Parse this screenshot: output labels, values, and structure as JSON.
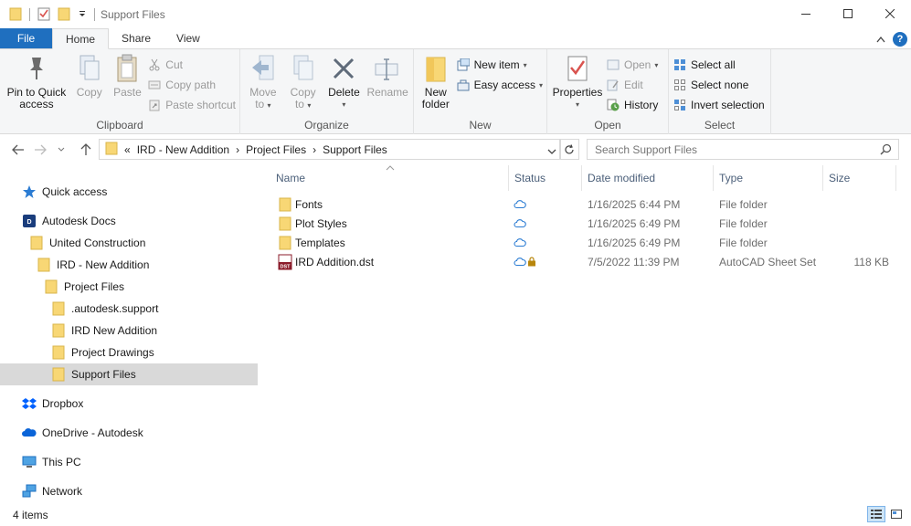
{
  "window": {
    "title": "Support Files"
  },
  "ribbon_tabs": [
    "File",
    "Home",
    "Share",
    "View"
  ],
  "ribbon": {
    "clipboard": {
      "label": "Clipboard",
      "pin_line1": "Pin to Quick",
      "pin_line2": "access",
      "copy": "Copy",
      "paste": "Paste",
      "cut": "Cut",
      "copy_path": "Copy path",
      "paste_shortcut": "Paste shortcut"
    },
    "organize": {
      "label": "Organize",
      "move_to_line1": "Move",
      "move_to_line2": "to",
      "copy_to_line1": "Copy",
      "copy_to_line2": "to",
      "delete": "Delete",
      "rename": "Rename"
    },
    "new": {
      "label": "New",
      "new_folder_line1": "New",
      "new_folder_line2": "folder",
      "new_item": "New item",
      "easy_access": "Easy access"
    },
    "open": {
      "label": "Open",
      "properties": "Properties",
      "open": "Open",
      "edit": "Edit",
      "history": "History"
    },
    "select": {
      "label": "Select",
      "select_all": "Select all",
      "select_none": "Select none",
      "invert_selection": "Invert selection"
    }
  },
  "address": {
    "prefix": "«",
    "crumbs": [
      "IRD - New Addition",
      "Project Files",
      "Support Files"
    ],
    "separator": "›"
  },
  "search": {
    "placeholder": "Search Support Files"
  },
  "nav": [
    {
      "label": "Quick access",
      "icon": "star-icon"
    },
    {
      "label": "Autodesk Docs",
      "icon": "autodesk-docs-icon"
    },
    {
      "label": "United Construction",
      "icon": "folder-icon"
    },
    {
      "label": "IRD - New Addition",
      "icon": "folder-icon"
    },
    {
      "label": "Project Files",
      "icon": "folder-icon"
    },
    {
      "label": ".autodesk.support",
      "icon": "folder-icon"
    },
    {
      "label": "IRD New Addition",
      "icon": "folder-icon"
    },
    {
      "label": "Project Drawings",
      "icon": "folder-icon"
    },
    {
      "label": "Support Files",
      "icon": "folder-icon",
      "selected": true
    },
    {
      "label": "Dropbox",
      "icon": "dropbox-icon"
    },
    {
      "label": "OneDrive - Autodesk",
      "icon": "onedrive-icon"
    },
    {
      "label": "This PC",
      "icon": "pc-icon"
    },
    {
      "label": "Network",
      "icon": "network-icon"
    }
  ],
  "columns": {
    "name": "Name",
    "status": "Status",
    "date_modified": "Date modified",
    "type": "Type",
    "size": "Size"
  },
  "files": [
    {
      "name": "Fonts",
      "date": "1/16/2025 6:44 PM",
      "type": "File folder",
      "size": "",
      "icon": "folder-icon",
      "status": "cloud-icon"
    },
    {
      "name": "Plot Styles",
      "date": "1/16/2025 6:49 PM",
      "type": "File folder",
      "size": "",
      "icon": "folder-icon",
      "status": "cloud-icon"
    },
    {
      "name": "Templates",
      "date": "1/16/2025 6:49 PM",
      "type": "File folder",
      "size": "",
      "icon": "folder-icon",
      "status": "cloud-icon"
    },
    {
      "name": "IRD Addition.dst",
      "date": "7/5/2022 11:39 PM",
      "type": "AutoCAD Sheet Set",
      "size": "118 KB",
      "icon": "dst-file-icon",
      "status": "cloud-lock-icon",
      "dst_badge": "DST"
    }
  ],
  "status_bar": {
    "item_count": "4 items"
  },
  "colors": {
    "file_tab": "#1f6fbf",
    "folder": "#f8d775",
    "selected_nav": "#d9d9d9",
    "header_text": "#4c607a"
  }
}
